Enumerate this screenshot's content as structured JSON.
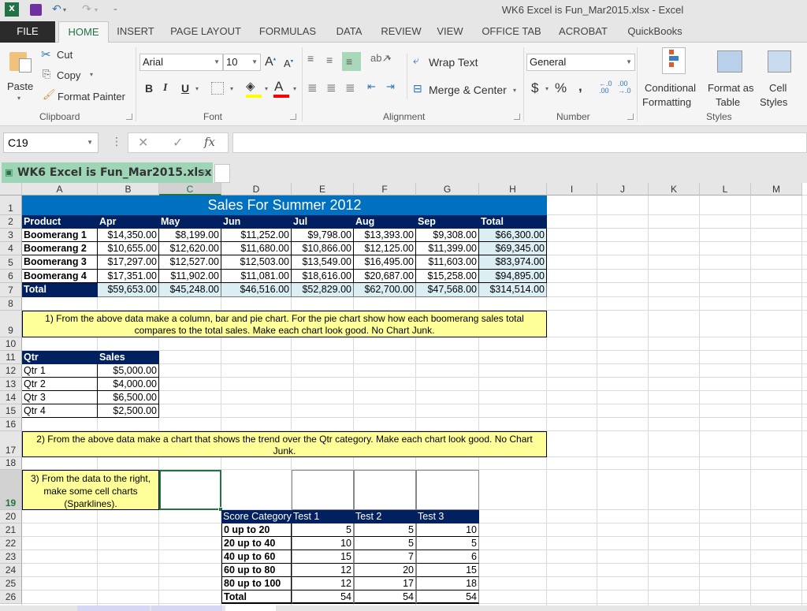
{
  "window": {
    "title": "WK6 Excel is Fun_Mar2015.xlsx - Excel"
  },
  "ribbon_tabs": [
    "FILE",
    "HOME",
    "INSERT",
    "PAGE LAYOUT",
    "FORMULAS",
    "DATA",
    "REVIEW",
    "VIEW",
    "OFFICE TAB",
    "ACROBAT",
    "QuickBooks"
  ],
  "ribbon": {
    "clipboard": {
      "paste": "Paste",
      "cut": "Cut",
      "copy": "Copy",
      "format_painter": "Format Painter",
      "label": "Clipboard"
    },
    "font": {
      "name": "Arial",
      "size": "10",
      "label": "Font",
      "bold": "B",
      "italic": "I",
      "underline": "U",
      "fill_color": "#ffff00",
      "font_color": "#ff0000"
    },
    "alignment": {
      "wrap_text": "Wrap Text",
      "merge_center": "Merge & Center",
      "label": "Alignment"
    },
    "number": {
      "format": "General",
      "currency": "$",
      "percent": "%",
      "comma": ",",
      "label": "Number"
    },
    "styles": {
      "conditional_1": "Conditional",
      "conditional_2": "Formatting",
      "format_table_1": "Format as",
      "format_table_2": "Table",
      "cell_styles_1": "Cell",
      "cell_styles_2": "Styles",
      "label": "Styles"
    }
  },
  "formula_bar": {
    "name_box": "C19",
    "fx": "fx",
    "value": ""
  },
  "doc_tab": {
    "label": "WK6 Excel is Fun_Mar2015.xlsx *"
  },
  "columns": [
    "A",
    "B",
    "C",
    "D",
    "E",
    "F",
    "G",
    "H",
    "I",
    "J",
    "K",
    "L",
    "M"
  ],
  "selected_cell": "C19",
  "rows": [
    "1",
    "2",
    "3",
    "4",
    "5",
    "6",
    "7",
    "8",
    "9",
    "10",
    "11",
    "12",
    "13",
    "14",
    "15",
    "16",
    "17",
    "18",
    "19",
    "20",
    "21",
    "22",
    "23",
    "24",
    "25",
    "26"
  ],
  "sales_table": {
    "title": "Sales For Summer 2012",
    "headers": [
      "Product",
      "Apr",
      "May",
      "Jun",
      "Jul",
      "Aug",
      "Sep",
      "Total"
    ],
    "rows": [
      [
        "Boomerang 1",
        "$14,350.00",
        "$8,199.00",
        "$11,252.00",
        "$9,798.00",
        "$13,393.00",
        "$9,308.00",
        "$66,300.00"
      ],
      [
        "Boomerang 2",
        "$10,655.00",
        "$12,620.00",
        "$11,680.00",
        "$10,866.00",
        "$12,125.00",
        "$11,399.00",
        "$69,345.00"
      ],
      [
        "Boomerang 3",
        "$17,297.00",
        "$12,527.00",
        "$12,503.00",
        "$13,549.00",
        "$16,495.00",
        "$11,603.00",
        "$83,974.00"
      ],
      [
        "Boomerang 4",
        "$17,351.00",
        "$11,902.00",
        "$11,081.00",
        "$18,616.00",
        "$20,687.00",
        "$15,258.00",
        "$94,895.00"
      ]
    ],
    "total": [
      "Total",
      "$59,653.00",
      "$45,248.00",
      "$46,516.00",
      "$52,829.00",
      "$62,700.00",
      "$47,568.00",
      "$314,514.00"
    ]
  },
  "note1": "1) From the above data make a column, bar and pie chart. For the pie chart show how each boomerang sales total compares to the total sales. Make each chart look good. No Chart Junk.",
  "qtr_table": {
    "headers": [
      "Qtr",
      "Sales"
    ],
    "rows": [
      [
        "Qtr 1",
        "$5,000.00"
      ],
      [
        "Qtr 2",
        "$4,000.00"
      ],
      [
        "Qtr 3",
        "$6,500.00"
      ],
      [
        "Qtr 4",
        "$2,500.00"
      ]
    ]
  },
  "note2": "2) From the above data make a chart that shows the trend over the Qtr category. Make each chart look good. No Chart Junk.",
  "note3": "3) From the data to the right, make some cell charts (Sparklines).",
  "score_table": {
    "headers": [
      "Score Category",
      "Test 1",
      "Test 2",
      "Test 3"
    ],
    "rows": [
      [
        "0 up to 20",
        "5",
        "5",
        "10"
      ],
      [
        "20 up to 40",
        "10",
        "5",
        "5"
      ],
      [
        "40 up to 60",
        "15",
        "7",
        "6"
      ],
      [
        "60 up to 80",
        "12",
        "20",
        "15"
      ],
      [
        "80 up to 100",
        "12",
        "17",
        "18"
      ],
      [
        "Total",
        "54",
        "54",
        "54"
      ]
    ]
  },
  "colors": {
    "title_band": "#0070c0",
    "header_dark": "#002060",
    "total_fill": "#dbeef4",
    "note_fill": "#ffff99",
    "excel_green": "#217346"
  }
}
